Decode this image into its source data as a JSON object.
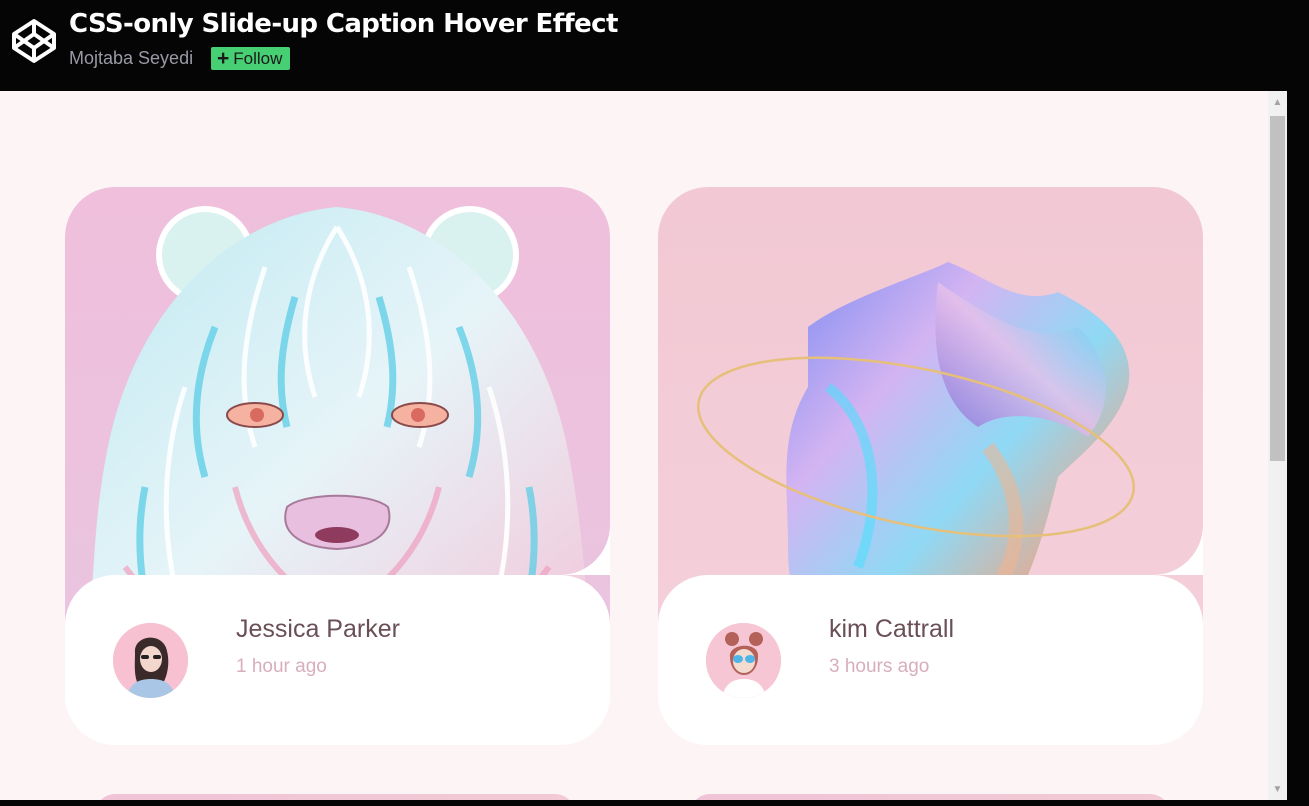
{
  "header": {
    "title": "CSS-only Slide-up Caption Hover Effect",
    "author": "Mojtaba Seyedi",
    "follow_label": "Follow"
  },
  "cards": [
    {
      "name": "Jessica Parker",
      "time": "1 hour ago",
      "image": "tiger-art"
    },
    {
      "name": "kim Cattrall",
      "time": "3 hours ago",
      "image": "iridescent-fabric-art"
    }
  ],
  "colors": {
    "page_bg": "#fdf5f5",
    "header_bg": "#050505",
    "follow_green": "#47cf73",
    "name_color": "#6a4f56",
    "time_color": "#d8aebd"
  }
}
